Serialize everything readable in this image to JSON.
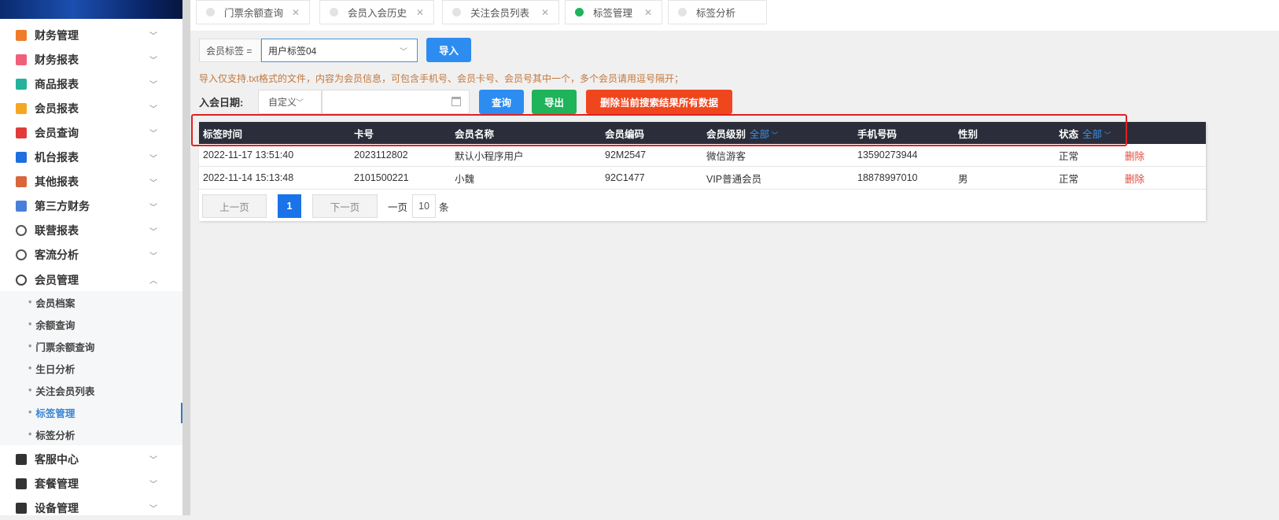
{
  "sidebar": {
    "items": [
      {
        "label": "财务管理",
        "icon": "calculator-icon",
        "color": "#f07b2a"
      },
      {
        "label": "财务报表",
        "icon": "report-icon",
        "color": "#f0607a"
      },
      {
        "label": "商品报表",
        "icon": "report-icon",
        "color": "#23b39a"
      },
      {
        "label": "会员报表",
        "icon": "report-icon",
        "color": "#f5a623"
      },
      {
        "label": "会员查询",
        "icon": "report-icon",
        "color": "#e03c3c"
      },
      {
        "label": "机台报表",
        "icon": "report-icon",
        "color": "#1f6fe0"
      },
      {
        "label": "其他报表",
        "icon": "layers-icon",
        "color": "#d9663a"
      },
      {
        "label": "第三方财务",
        "icon": "calculator-icon",
        "color": "#4a7fd9"
      },
      {
        "label": "联营报表",
        "icon": "users-icon",
        "color": "#555"
      },
      {
        "label": "客流分析",
        "icon": "target-icon",
        "color": "#555"
      },
      {
        "label": "会员管理",
        "icon": "user-circle-icon",
        "color": "#444"
      }
    ],
    "sub_items": [
      "会员档案",
      "余额查询",
      "门票余额查询",
      "生日分析",
      "关注会员列表",
      "标签管理",
      "标签分析"
    ],
    "bottom_items": [
      {
        "label": "客服中心",
        "icon": "headset-icon"
      },
      {
        "label": "套餐管理",
        "icon": "edit-icon"
      },
      {
        "label": "设备管理",
        "icon": "tool-icon"
      }
    ]
  },
  "tabs": [
    "门票余额查询",
    "会员入会历史",
    "关注会员列表",
    "标签管理",
    "标签分析"
  ],
  "filter": {
    "tag_label": "会员标签 =",
    "tag_value": "用户标签04",
    "import": "导入",
    "hint": "导入仅支持.txt格式的文件，内容为会员信息，可包含手机号、会员卡号、会员号其中一个，多个会员请用逗号隔开；",
    "date_label": "入会日期:",
    "date_mode": "自定义",
    "query": "查询",
    "export": "导出",
    "delete_all": "删除当前搜索结果所有数据"
  },
  "table": {
    "headers": [
      "标签时间",
      "卡号",
      "会员名称",
      "会员编码",
      "会员级别",
      "手机号码",
      "性别",
      "状态"
    ],
    "level_filter": "全部",
    "status_filter": "全部",
    "rows": [
      [
        "2022-11-17 13:51:40",
        "2023112802",
        "默认小程序用户",
        "92M2547",
        "微信游客",
        "13590273944",
        "",
        "正常",
        "删除"
      ],
      [
        "2022-11-14 15:13:48",
        "2101500221",
        "小魏",
        "92C1477",
        "VIP普通会员",
        "18878997010",
        "男",
        "正常",
        "删除"
      ]
    ]
  },
  "pagination": {
    "prev": "上一页",
    "page": "1",
    "next": "下一页",
    "per_page_label": "一页",
    "per_page": "10",
    "unit": "条"
  },
  "colors": {
    "primary": "#2d8cf0",
    "success": "#1fb35a",
    "danger": "#f0461e",
    "header": "#2b2e3a"
  }
}
